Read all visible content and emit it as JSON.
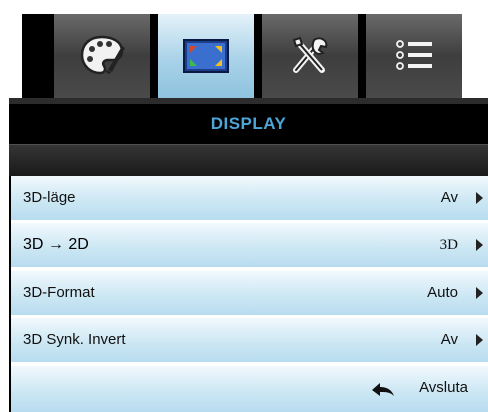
{
  "tabs": [
    {
      "icon": "palette-icon",
      "active": false
    },
    {
      "icon": "display-screen-icon",
      "active": true
    },
    {
      "icon": "tools-icon",
      "active": false
    },
    {
      "icon": "list-menu-icon",
      "active": false
    }
  ],
  "header": {
    "title": "DISPLAY"
  },
  "menu": {
    "rows": [
      {
        "label": "3D-läge",
        "value": "Av"
      },
      {
        "label": "3D → 2D",
        "value": "3D"
      },
      {
        "label": "3D-Format",
        "value": "Auto"
      },
      {
        "label": "3D Synk. Invert",
        "value": "Av"
      }
    ]
  },
  "footer": {
    "exit_label": "Avsluta"
  },
  "colors": {
    "header_text": "#4da5d8",
    "row_bg": "#cae6f3",
    "active_tab": "#a9d2e8"
  }
}
